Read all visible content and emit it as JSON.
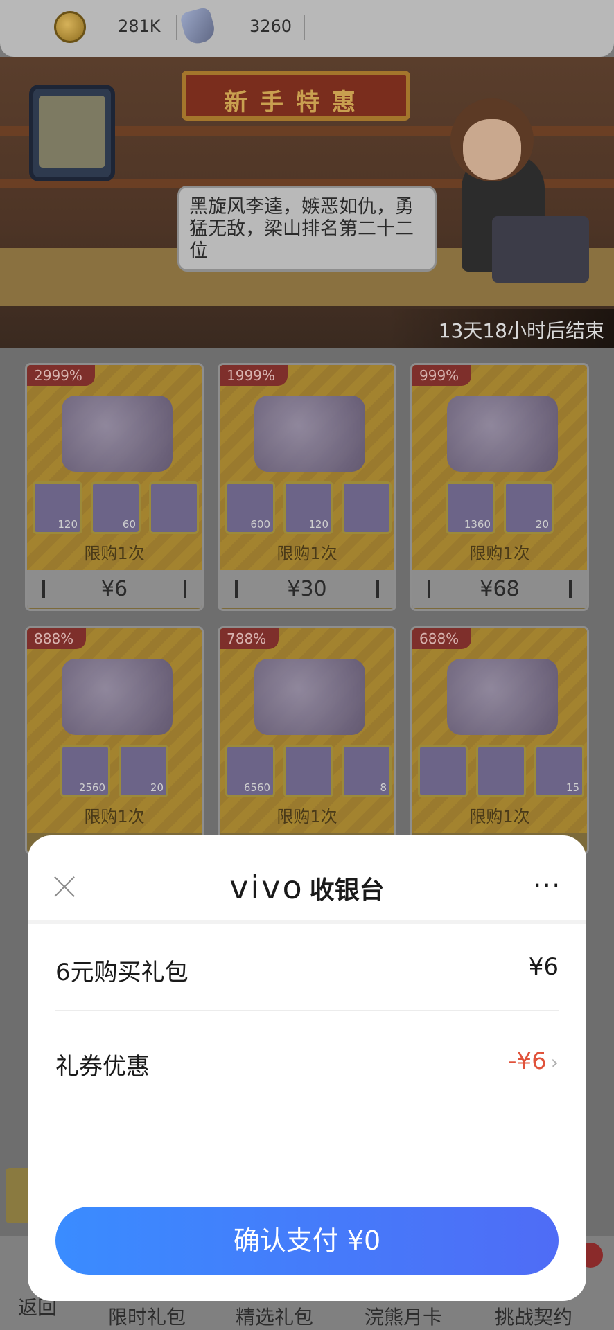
{
  "currency": {
    "coins": "281K",
    "gems": "3260"
  },
  "banner": {
    "sign": "新手特惠",
    "dialogue": "黑旋风李逵，嫉恶如仇，勇猛无敌，梁山排名第二十二位",
    "countdown": "13天18小时后结束"
  },
  "packs": [
    {
      "tag": "2999%",
      "items": [
        "120",
        "60",
        ""
      ],
      "limit": "限购1次",
      "price": "¥6"
    },
    {
      "tag": "1999%",
      "items": [
        "600",
        "120",
        ""
      ],
      "limit": "限购1次",
      "price": "¥30"
    },
    {
      "tag": "999%",
      "items": [
        "1360",
        "20"
      ],
      "limit": "限购1次",
      "price": "¥68"
    },
    {
      "tag": "888%",
      "items": [
        "2560",
        "20"
      ],
      "limit": "限购1次",
      "price": ""
    },
    {
      "tag": "788%",
      "items": [
        "6560",
        "",
        "8"
      ],
      "limit": "限购1次",
      "price": ""
    },
    {
      "tag": "688%",
      "items": [
        "",
        "",
        "15"
      ],
      "limit": "限购1次",
      "price": ""
    }
  ],
  "bottom_nav": {
    "back": "返回",
    "items": [
      "限时礼包",
      "精选礼包",
      "浣熊月卡",
      "挑战契约"
    ]
  },
  "payment": {
    "brand": "vivo",
    "title": "收银台",
    "more": "···",
    "item_label": "6元购买礼包",
    "item_value": "¥6",
    "discount_label": "礼券优惠",
    "discount_value": "-¥6",
    "confirm_label": "确认支付  ¥0"
  }
}
